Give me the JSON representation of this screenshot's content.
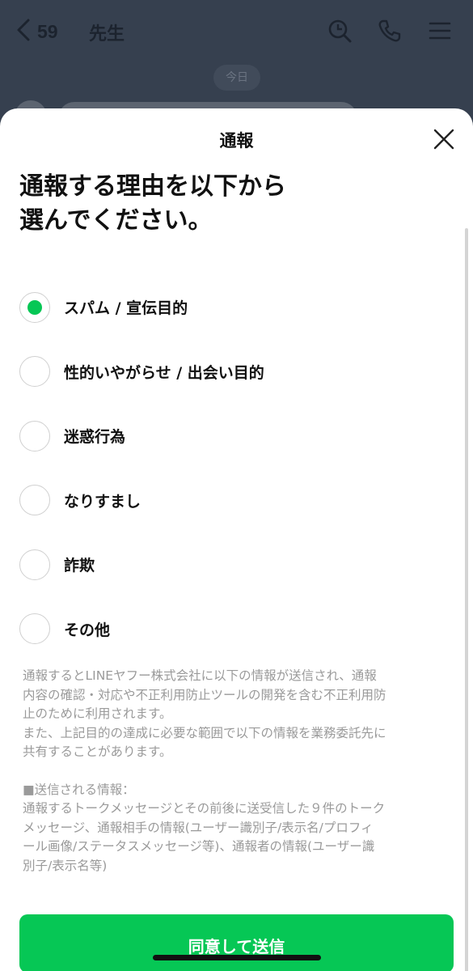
{
  "chat": {
    "back_count": "59",
    "title": "先生",
    "date_label": "今日",
    "icons": [
      "chevron-left-icon",
      "search-icon",
      "phone-icon",
      "menu-icon"
    ]
  },
  "sheet": {
    "title": "通報",
    "close_icon": "close-icon",
    "prompt_line1": "通報する理由を以下から",
    "prompt_line2": "選んでください。",
    "options": [
      {
        "label": "スパム / 宣伝目的",
        "selected": true
      },
      {
        "label": "性的いやがらせ / 出会い目的",
        "selected": false
      },
      {
        "label": "迷惑行為",
        "selected": false
      },
      {
        "label": "なりすまし",
        "selected": false
      },
      {
        "label": "詐欺",
        "selected": false
      },
      {
        "label": "その他",
        "selected": false
      }
    ],
    "notice": {
      "line1": "通報するとLINEヤフー株式会社に以下の情報が送信され、通報",
      "line2": "内容の確認・対応や不正利用防止ツールの開発を含む不正利用防",
      "line3": "止のために利用されます。",
      "line4": "また、上記目的の達成に必要な範囲で以下の情報を業務委託先に",
      "line5": "共有することがあります。",
      "line6": "■送信される情報：",
      "line7": "通報するトークメッセージとその前後に送受信した９件のトーク",
      "line8": "メッセージ、通報相手の情報(ユーザー識別子/表示名/プロフィ",
      "line9": "ール画像/ステータスメッセージ等)、通報者の情報(ユーザー識",
      "line10": "別子/表示名等)"
    },
    "submit_label": "同意して送信"
  },
  "colors": {
    "accent": "#06c755",
    "overlay": "#36404f",
    "notice_text": "#9a9a9a"
  }
}
